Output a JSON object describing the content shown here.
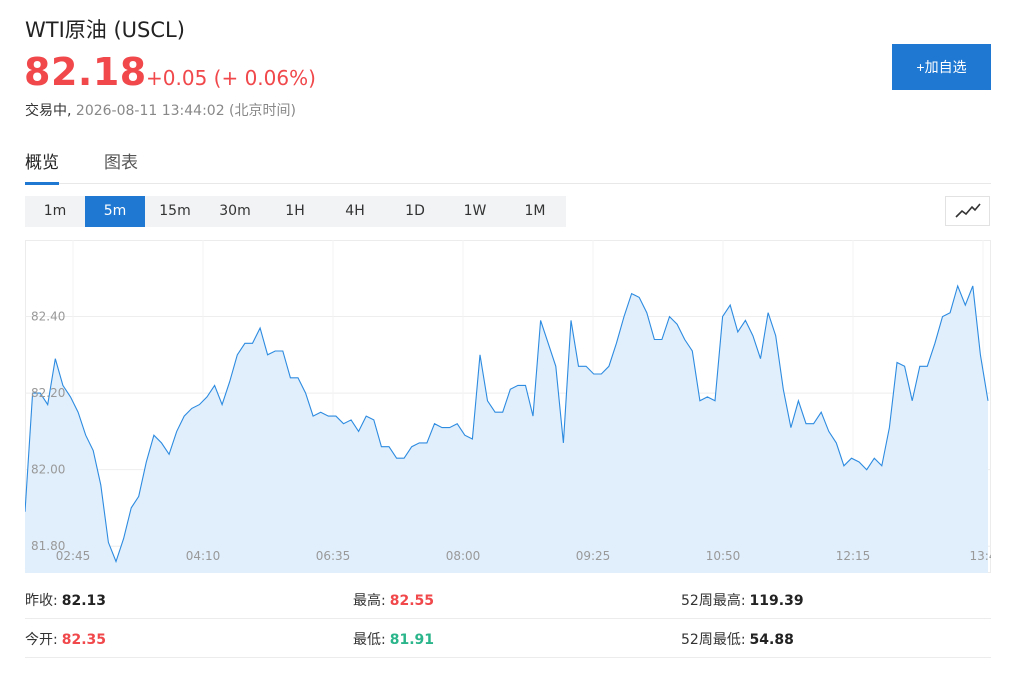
{
  "header": {
    "title": "WTI原油 (USCL)",
    "price": "82.18",
    "change": "+0.05",
    "change_pct": "(+ 0.06%)",
    "status": "交易中,",
    "timestamp": "2026-08-11 13:44:02 (北京时间)",
    "add_button": "+加自选"
  },
  "tabs": [
    {
      "label": "概览",
      "active": true
    },
    {
      "label": "图表",
      "active": false
    }
  ],
  "periods": [
    {
      "label": "1m",
      "active": false
    },
    {
      "label": "5m",
      "active": true
    },
    {
      "label": "15m",
      "active": false
    },
    {
      "label": "30m",
      "active": false
    },
    {
      "label": "1H",
      "active": false
    },
    {
      "label": "4H",
      "active": false
    },
    {
      "label": "1D",
      "active": false
    },
    {
      "label": "1W",
      "active": false
    },
    {
      "label": "1M",
      "active": false
    }
  ],
  "chart_type_icon": "line-chart-icon",
  "chart_data": {
    "type": "area",
    "x_ticks": [
      "02:45",
      "04:10",
      "06:35",
      "08:00",
      "09:25",
      "10:50",
      "12:15",
      "13:4"
    ],
    "y_ticks": [
      "82.40",
      "82.20",
      "82.00",
      "81.80"
    ],
    "ylim": [
      81.73,
      82.6
    ],
    "grid": true,
    "color": "#2d8be0",
    "fill": "#e1effc",
    "values": [
      81.89,
      82.2,
      82.2,
      82.17,
      82.29,
      82.22,
      82.19,
      82.15,
      82.09,
      82.05,
      81.96,
      81.81,
      81.76,
      81.82,
      81.9,
      81.93,
      82.02,
      82.09,
      82.07,
      82.04,
      82.1,
      82.14,
      82.16,
      82.17,
      82.19,
      82.22,
      82.17,
      82.23,
      82.3,
      82.33,
      82.33,
      82.37,
      82.3,
      82.31,
      82.31,
      82.24,
      82.24,
      82.2,
      82.14,
      82.15,
      82.14,
      82.14,
      82.12,
      82.13,
      82.1,
      82.14,
      82.13,
      82.06,
      82.06,
      82.03,
      82.03,
      82.06,
      82.07,
      82.07,
      82.12,
      82.11,
      82.11,
      82.12,
      82.09,
      82.08,
      82.3,
      82.18,
      82.15,
      82.15,
      82.21,
      82.22,
      82.22,
      82.14,
      82.39,
      82.33,
      82.27,
      82.07,
      82.39,
      82.27,
      82.27,
      82.25,
      82.25,
      82.27,
      82.33,
      82.4,
      82.46,
      82.45,
      82.41,
      82.34,
      82.34,
      82.4,
      82.38,
      82.34,
      82.31,
      82.18,
      82.19,
      82.18,
      82.4,
      82.43,
      82.36,
      82.39,
      82.35,
      82.29,
      82.41,
      82.35,
      82.21,
      82.11,
      82.18,
      82.12,
      82.12,
      82.15,
      82.1,
      82.07,
      82.01,
      82.03,
      82.02,
      82.0,
      82.03,
      82.01,
      82.11,
      82.28,
      82.27,
      82.18,
      82.27,
      82.27,
      82.33,
      82.4,
      82.41,
      82.48,
      82.43,
      82.48,
      82.3,
      82.18
    ]
  },
  "stats": [
    [
      {
        "label": "昨收:",
        "value": "82.13",
        "tone": "neu"
      },
      {
        "label": "最高:",
        "value": "82.55",
        "tone": "up"
      },
      {
        "label": "52周最高:",
        "value": "119.39",
        "tone": "neu"
      }
    ],
    [
      {
        "label": "今开:",
        "value": "82.35",
        "tone": "up"
      },
      {
        "label": "最低:",
        "value": "81.91",
        "tone": "down"
      },
      {
        "label": "52周最低:",
        "value": "54.88",
        "tone": "neu"
      }
    ]
  ]
}
